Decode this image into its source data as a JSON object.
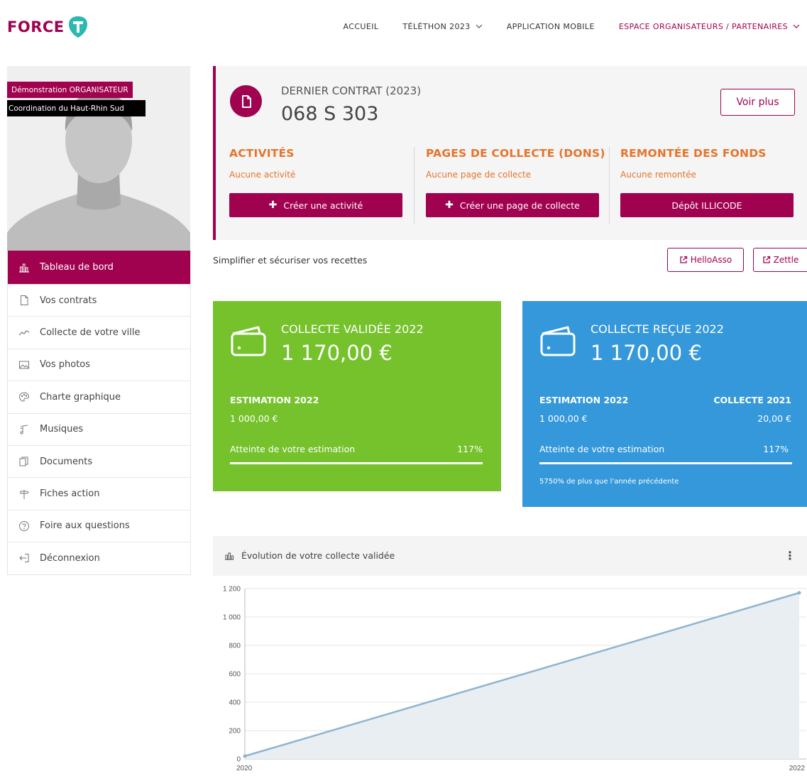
{
  "header": {
    "logo_text": "FORCE",
    "nav": [
      {
        "label": "ACCUEIL",
        "dropdown": false
      },
      {
        "label": "TÉLÉTHON 2023",
        "dropdown": true
      },
      {
        "label": "APPLICATION MOBILE",
        "dropdown": false
      },
      {
        "label": "ESPACE ORGANISATEURS / PARTENAIRES",
        "dropdown": true
      }
    ]
  },
  "profile": {
    "role": "Démonstration ORGANISATEUR",
    "organisation": "Coordination du Haut-Rhin Sud"
  },
  "sidebar": {
    "items": [
      {
        "label": "Tableau de bord",
        "icon": "bar-chart-icon",
        "active": true
      },
      {
        "label": "Vos contrats",
        "icon": "file-icon",
        "active": false
      },
      {
        "label": "Collecte de votre ville",
        "icon": "line-chart-icon",
        "active": false
      },
      {
        "label": "Vos photos",
        "icon": "image-icon",
        "active": false
      },
      {
        "label": "Charte graphique",
        "icon": "palette-icon",
        "active": false
      },
      {
        "label": "Musiques",
        "icon": "music-icon",
        "active": false
      },
      {
        "label": "Documents",
        "icon": "documents-icon",
        "active": false
      },
      {
        "label": "Fiches action",
        "icon": "signpost-icon",
        "active": false
      },
      {
        "label": "Foire aux questions",
        "icon": "question-icon",
        "active": false
      },
      {
        "label": "Déconnexion",
        "icon": "logout-icon",
        "active": false
      }
    ]
  },
  "contract": {
    "label": "DERNIER CONTRAT (2023)",
    "number": "068 S 303",
    "more_label": "Voir plus",
    "columns": [
      {
        "title": "ACTIVITÉS",
        "subtitle": "Aucune activité",
        "button": "Créer une activité",
        "has_plus": true
      },
      {
        "title": "PAGES DE COLLECTE (DONS)",
        "subtitle": "Aucune page de collecte",
        "button": "Créer une page de collecte",
        "has_plus": true
      },
      {
        "title": "REMONTÉE DES FONDS",
        "subtitle": "Aucune remontée",
        "button": "Dépôt ILLICODE",
        "has_plus": false
      }
    ]
  },
  "recettes": {
    "label": "Simplifier et sécuriser vos recettes",
    "links": [
      "HelloAsso",
      "Zettle"
    ]
  },
  "cards": {
    "validated": {
      "title": "COLLECTE VALIDÉE 2022",
      "amount": "1 170,00 €",
      "estimation_label": "ESTIMATION 2022",
      "estimation_value": "1 000,00 €",
      "reach_label": "Atteinte de votre estimation",
      "reach_pct": "117%",
      "progress": 1.0,
      "color": "#75c22c"
    },
    "received": {
      "title": "COLLECTE REÇUE 2022",
      "amount": "1 170,00 €",
      "estimation_label": "ESTIMATION 2022",
      "estimation_value": "1 000,00 €",
      "previous_label": "COLLECTE 2021",
      "previous_value": "20,00 €",
      "reach_label": "Atteinte de votre estimation",
      "reach_pct": "117%",
      "progress": 1.0,
      "note": "5750% de plus que l'année précédente",
      "color": "#3498db"
    }
  },
  "chart_panel": {
    "title": "Évolution de votre collecte validée"
  },
  "chart_data": {
    "type": "area",
    "x": [
      "2020",
      "2022"
    ],
    "values": [
      20,
      1170
    ],
    "ylim": [
      0,
      1200
    ],
    "yticks": [
      "0",
      "200",
      "400",
      "600",
      "800",
      "1 000",
      "1 200"
    ],
    "grid": true,
    "color": "#8fb4cf"
  },
  "colors": {
    "brand": "#a0024f",
    "accent": "#e6742b"
  }
}
